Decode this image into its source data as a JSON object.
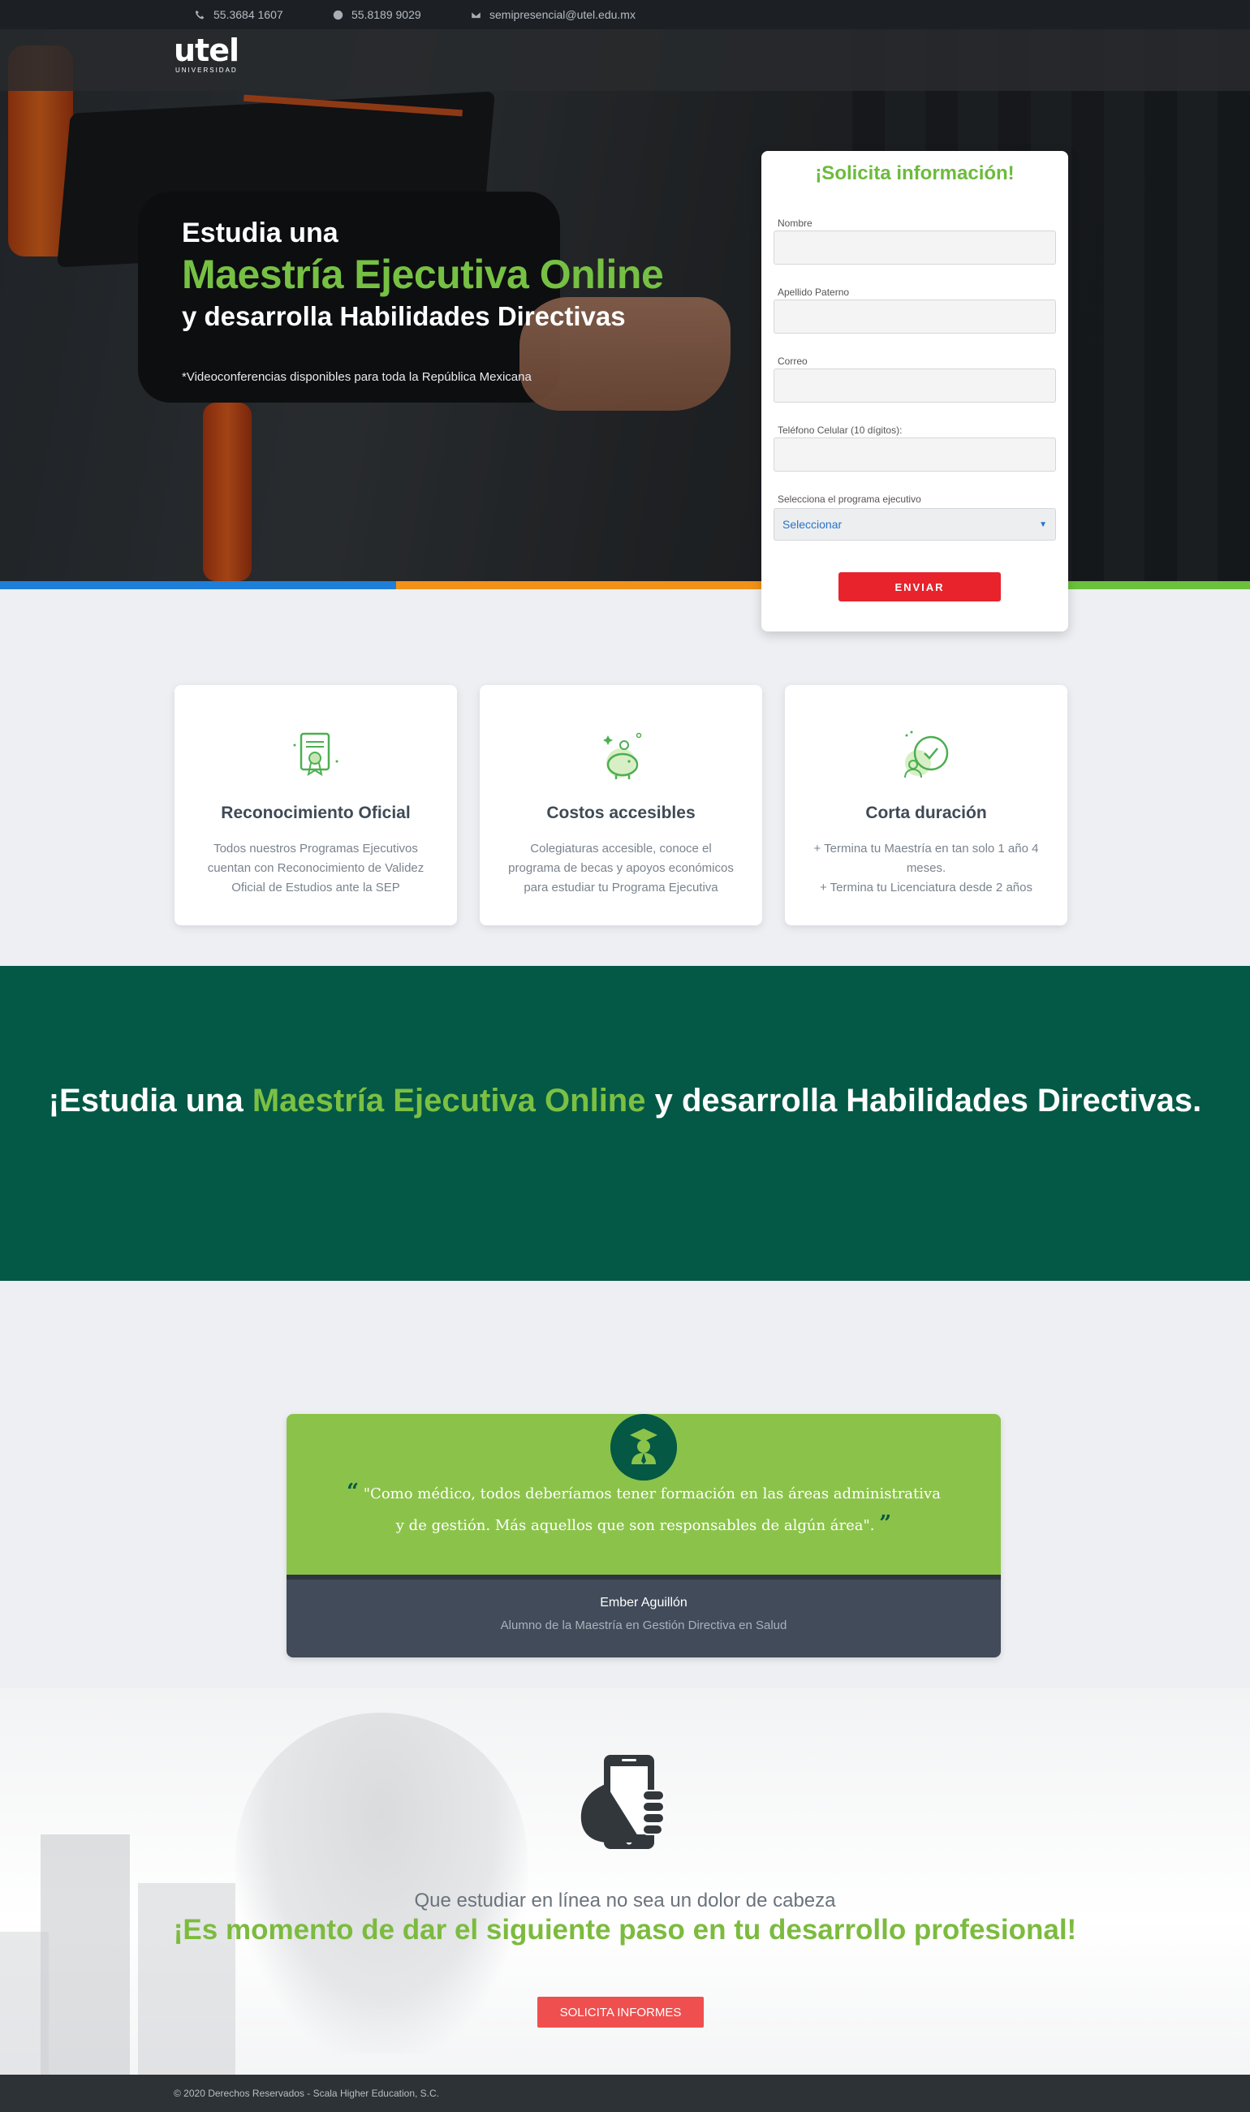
{
  "topbar": {
    "phone1": "55.3684 1607",
    "phone2": "55.8189 9029",
    "email": "semipresencial@utel.edu.mx"
  },
  "logo": {
    "word": "utel",
    "sub": "UNIVERSIDAD"
  },
  "hero": {
    "line1": "Estudia una",
    "line2": "Maestría Ejecutiva Online",
    "line3": "y desarrolla Habilidades Directivas",
    "note": "*Videoconferencias disponibles para toda la República Mexicana"
  },
  "form": {
    "title": "¡Solicita información!",
    "fields": [
      {
        "label": "Nombre",
        "value": ""
      },
      {
        "label": "Apellido Paterno",
        "value": ""
      },
      {
        "label": "Correo",
        "value": ""
      },
      {
        "label": "Teléfono Celular (10 dígitos):",
        "value": ""
      }
    ],
    "select_label": "Selecciona el programa ejecutivo",
    "select_value": "Seleccionar",
    "submit": "ENVIAR"
  },
  "stripe_colors": [
    "#1e7fd8",
    "#f39218",
    "#6cc13c"
  ],
  "cards": [
    {
      "icon": "certificate-icon",
      "title": "Reconocimiento Oficial",
      "desc": "Todos nuestros Programas Ejecutivos cuentan con Reconocimiento de Validez Oficial de Estudios ante la SEP"
    },
    {
      "icon": "piggy-bank-icon",
      "title": "Costos accesibles",
      "desc": "Colegiaturas accesible, conoce el programa de becas y apoyos económicos para estudiar tu Programa Ejecutiva"
    },
    {
      "icon": "clock-user-icon",
      "title": "Corta duración",
      "desc": "+ Termina tu Maestría en tan solo 1 año 4 meses.\n+ Termina tu Licenciatura desde 2 años"
    }
  ],
  "banner": {
    "pre": "¡Estudia una ",
    "highlight": "Maestría Ejecutiva Online",
    "post": " y desarrolla Habilidades Directivas."
  },
  "testimonial": {
    "quote": "\"Como médico, todos deberíamos tener formación en las áreas administrativa y de gestión. Más aquellos que son responsables de algún área\".",
    "name": "Ember Aguillón",
    "role": "Alumno de la Maestría en Gestión Directiva en Salud"
  },
  "cta_section": {
    "line1": "Que estudiar en línea no sea un dolor de cabeza",
    "line2": "¡Es momento de dar el siguiente paso en tu desarrollo profesional!",
    "button": "SOLICITA INFORMES"
  },
  "footer": {
    "copyright": "© 2020 Derechos Reservados - Scala Higher Education, S.C."
  },
  "colors": {
    "accent_green": "#76c043",
    "dark_green": "#035945",
    "red": "#e8232c"
  }
}
